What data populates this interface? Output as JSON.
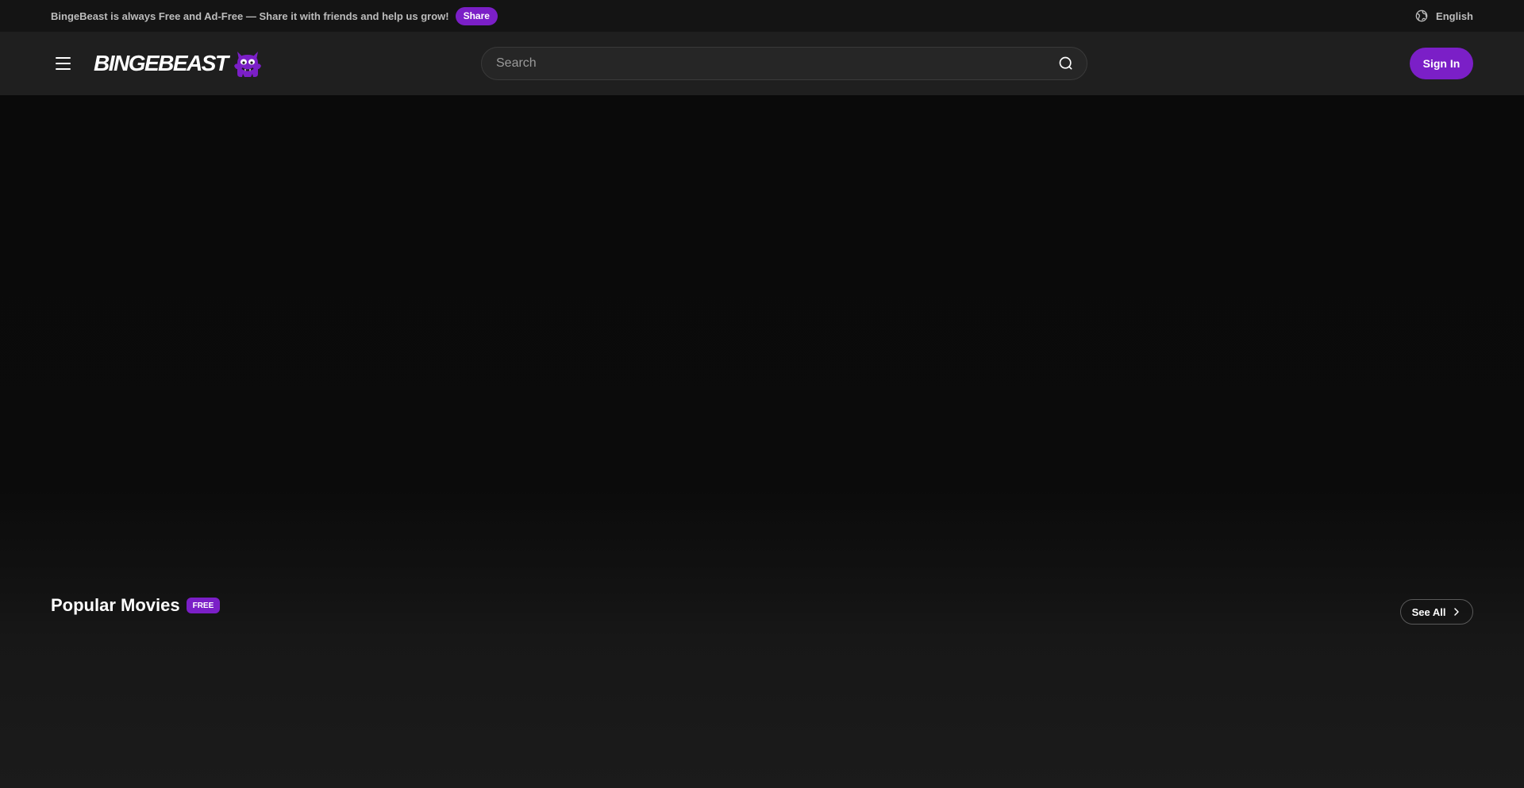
{
  "announcement": {
    "message": "BingeBeast is always Free and Ad-Free — Share it with friends and help us grow!",
    "share_label": "Share",
    "language": "English"
  },
  "header": {
    "logo_text": "BINGEBEAST",
    "search_placeholder": "Search",
    "sign_in_label": "Sign In"
  },
  "popular_movies": {
    "title": "Popular Movies",
    "badge": "FREE",
    "see_all_label": "See All"
  },
  "colors": {
    "accent": "#7b1fc7",
    "background": "#0b0b0b",
    "header_bg": "#1f1f1f",
    "topbar_bg": "#141414"
  },
  "icons": {
    "menu": "hamburger-icon",
    "logo_mascot": "monster-mascot-icon",
    "search": "search-icon",
    "language": "globe-icon",
    "see_all": "chevron-right-icon"
  }
}
